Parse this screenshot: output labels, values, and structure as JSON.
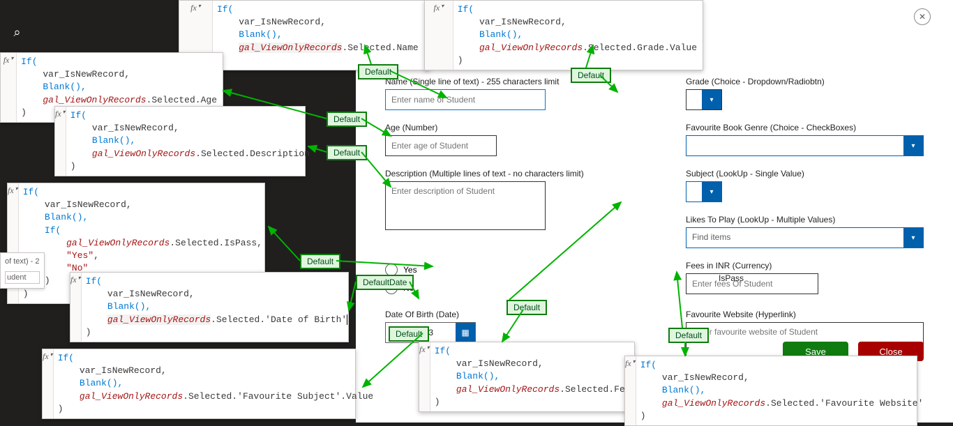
{
  "search_icon": "⌕",
  "fx_label": "fx",
  "close_icon": "✕",
  "snippets": {
    "name": {
      "if": "If(",
      "line1": "var_IsNewRecord,",
      "line2": "Blank(),",
      "gal": "gal_ViewOnlyRecords",
      "tail": ".Selected.Name",
      "close": ")"
    },
    "grade": {
      "if": "If(",
      "line1": "var_IsNewRecord,",
      "line2": "Blank(),",
      "gal": "gal_ViewOnlyRecords",
      "tail": ".Selected.Grade.Value",
      "close": ")"
    },
    "age": {
      "if": "If(",
      "line1": "var_IsNewRecord,",
      "line2": "Blank(),",
      "gal": "gal_ViewOnlyRecords",
      "tail": ".Selected.Age",
      "close": ")"
    },
    "desc": {
      "if": "If(",
      "line1": "var_IsNewRecord,",
      "line2": "Blank(),",
      "gal": "gal_ViewOnlyRecords",
      "tail": ".Selected.Description",
      "close": ")"
    },
    "ispass": {
      "if": "If(",
      "line1": "var_IsNewRecord,",
      "line2": "Blank(),",
      "ifinner": "If(",
      "gal": "gal_ViewOnlyRecords",
      "tail": ".Selected.IsPass,",
      "yes": "\"Yes\"",
      "no": "\"No\"",
      "close1": ")",
      "close2": ")"
    },
    "dob": {
      "if": "If(",
      "line1": "var_IsNewRecord,",
      "line2": "Blank(),",
      "gal": "gal_ViewOnlyRecords",
      "tail": ".Selected.'Date of Birth'",
      "close": ")"
    },
    "favsubject": {
      "if": "If(",
      "line1": "var_IsNewRecord,",
      "line2": "Blank(),",
      "gal": "gal_ViewOnlyRecords",
      "tail": ".Selected.'Favourite Subject'.Value",
      "close": ")"
    },
    "fees": {
      "if": "If(",
      "line1": "var_IsNewRecord,",
      "line2": "Blank(),",
      "gal": "gal_ViewOnlyRecords",
      "tail": ".Selected.Fees",
      "close": ")"
    },
    "website": {
      "if": "If(",
      "line1": "var_IsNewRecord,",
      "line2": "Blank(),",
      "gal": "gal_ViewOnlyRecords",
      "tail": ".Selected.'Favourite Website'",
      "close": ")"
    }
  },
  "tags": {
    "default": "Default",
    "default_date": "DefaultDate"
  },
  "crumb": {
    "l1": "of text) - 2",
    "l2": "udent"
  },
  "form": {
    "name_label": "Name (Single line of text) - 255 characters limit",
    "name_placeholder": "Enter name of Student",
    "age_label": "Age (Number)",
    "age_placeholder": "Enter age of Student",
    "desc_label": "Description (Multiple lines of text - no characters limit)",
    "desc_placeholder": "Enter description of Student",
    "ispass_label": "IsPass",
    "yes": "Yes",
    "no": "No",
    "dob_label": "Date Of Birth (Date)",
    "dob_value": "09/01/2023",
    "grade_label": "Grade (Choice - Dropdown/Radiobtn)",
    "genre_label": "Favourite Book Genre (Choice - CheckBoxes)",
    "subject_label": "Subject (LookUp - Single Value)",
    "likes_label": "Likes To Play (LookUp - Multiple Values)",
    "likes_placeholder": "Find items",
    "fees_label": "Fees in INR (Currency)",
    "fees_placeholder": "Enter fees Of Student",
    "website_label": "Favourite Website (Hyperlink)",
    "website_placeholder": "Enter favourite website of Student",
    "save": "Save",
    "close": "Close"
  }
}
